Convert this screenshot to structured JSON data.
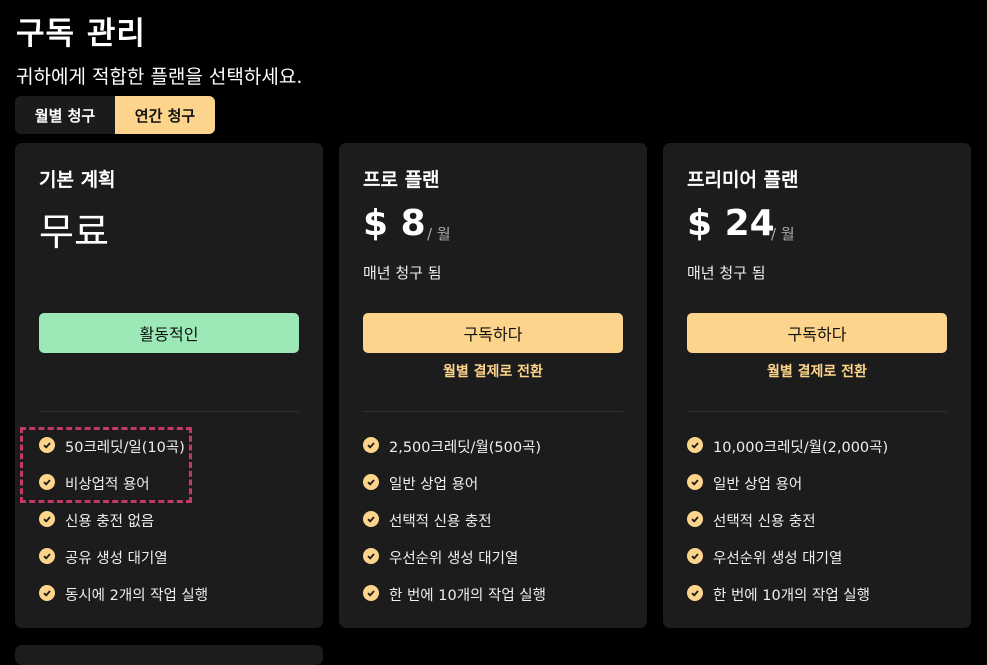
{
  "page": {
    "title": "구독 관리",
    "subtitle": "귀하에게 적합한 플랜을 선택하세요."
  },
  "billing": {
    "monthly_label": "월별 청구",
    "yearly_label": "연간 청구",
    "selected": "yearly"
  },
  "colors": {
    "accent": "#fdd48b",
    "active": "#9ce8b6",
    "highlight": "#c2386c",
    "card_bg": "#1c1c1c"
  },
  "plans": [
    {
      "name": "기본 계획",
      "price": "무료",
      "button": "활동적인",
      "features": [
        "50크레딧/일(10곡)",
        "비상업적 용어",
        "신용 충전 없음",
        "공유 생성 대기열",
        "동시에 2개의 작업 실행"
      ]
    },
    {
      "name": "프로 플랜",
      "price": "$ 8",
      "per": "/ 월",
      "billed": "매년 청구 됨",
      "button": "구독하다",
      "switch": "월별 결제로 전환",
      "features": [
        "2,500크레딧/월(500곡)",
        "일반 상업 용어",
        "선택적 신용 충전",
        "우선순위 생성 대기열",
        "한 번에 10개의 작업 실행"
      ]
    },
    {
      "name": "프리미어 플랜",
      "price": "$ 24",
      "per": "/ 월",
      "billed": "매년 청구 됨",
      "button": "구독하다",
      "switch": "월별 결제로 전환",
      "features": [
        "10,000크레딧/월(2,000곡)",
        "일반 상업 용어",
        "선택적 신용 충전",
        "우선순위 생성 대기열",
        "한 번에 10개의 작업 실행"
      ]
    }
  ]
}
